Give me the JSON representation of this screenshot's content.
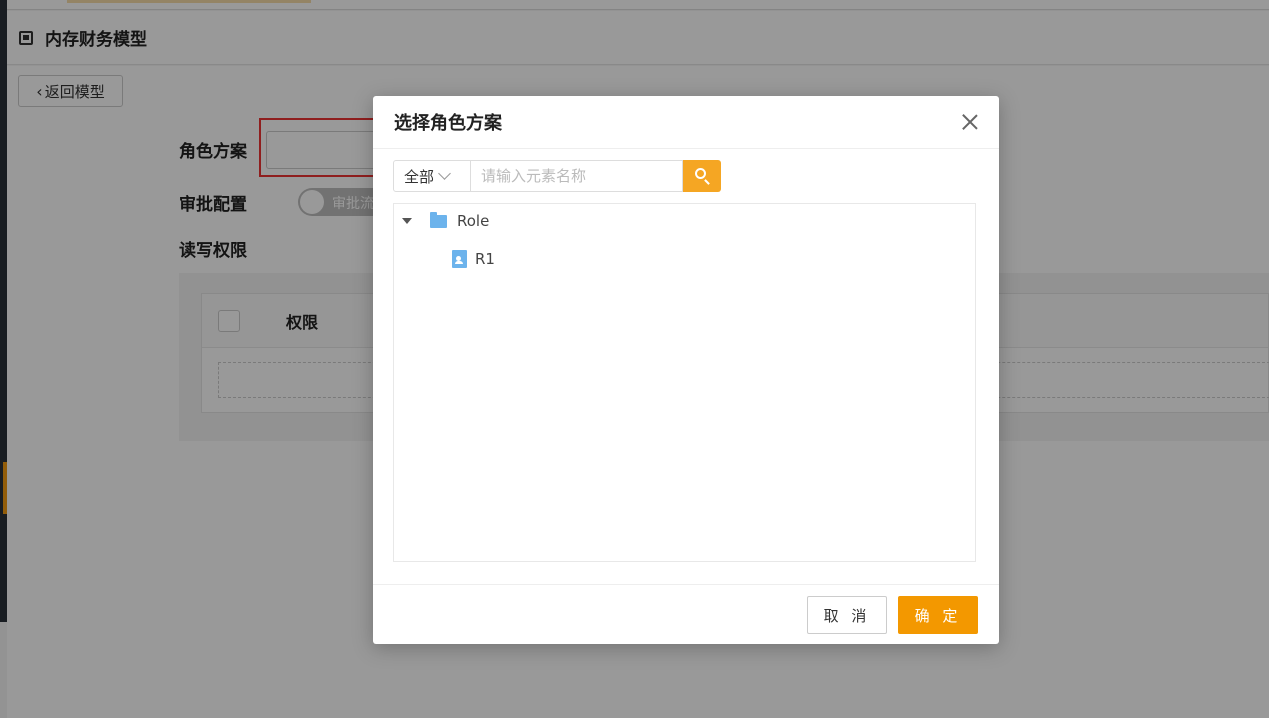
{
  "page": {
    "title": "内存财务模型",
    "back_label": "返回模型"
  },
  "form": {
    "role_label": "角色方案",
    "approval_label": "审批配置",
    "approval_toggle_text": "审批流",
    "rw_label": "读写权限",
    "perm_column": "权限"
  },
  "modal": {
    "title": "选择角色方案",
    "scope": "全部",
    "search_placeholder": "请输入元素名称",
    "tree": {
      "root": "Role",
      "children": [
        "R1"
      ]
    },
    "cancel_label": "取 消",
    "ok_label": "确 定"
  },
  "colors": {
    "accent": "#f39800",
    "folder": "#6cb3ec",
    "highlight_border": "#e33333"
  }
}
